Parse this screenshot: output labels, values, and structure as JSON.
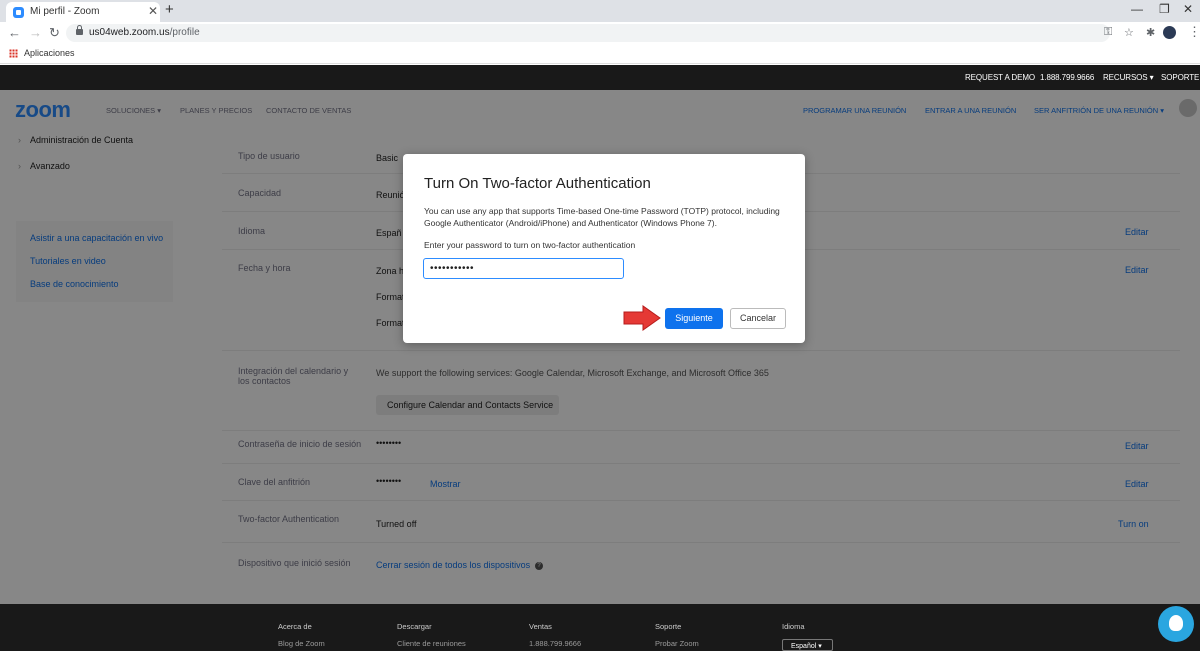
{
  "browser": {
    "tab_title": "Mi perfil - Zoom",
    "url_host": "us04web.zoom.us",
    "url_path": "/profile",
    "bookmark_apps": "Aplicaciones"
  },
  "topbar": {
    "request_demo": "REQUEST A DEMO",
    "phone": "1.888.799.9666",
    "recursos": "RECURSOS",
    "soporte": "SOPORTE"
  },
  "nav": {
    "logo": "zoom",
    "soluciones": "SOLUCIONES",
    "planes": "PLANES Y PRECIOS",
    "contacto": "CONTACTO DE VENTAS",
    "programar": "PROGRAMAR UNA REUNIÓN",
    "entrar": "ENTRAR A UNA REUNIÓN",
    "anfitrion": "SER ANFITRIÓN DE UNA REUNIÓN"
  },
  "sidebar": {
    "items": [
      {
        "label": "Administración de Cuenta"
      },
      {
        "label": "Avanzado"
      }
    ],
    "help": [
      {
        "label": "Asistir a una capacitación en vivo"
      },
      {
        "label": "Tutoriales en video"
      },
      {
        "label": "Base de conocimiento"
      }
    ]
  },
  "profile": {
    "tipo_usuario": {
      "label": "Tipo de usuario",
      "value": "Basic"
    },
    "capacidad": {
      "label": "Capacidad",
      "value": "Reunió"
    },
    "idioma": {
      "label": "Idioma",
      "value": "Españ",
      "edit": "Editar"
    },
    "fecha_hora": {
      "label": "Fecha y hora",
      "zona": "Zona h",
      "formato1": "Format",
      "formato2": "Format",
      "edit": "Editar"
    },
    "calendario": {
      "label": "Integración del calendario y los contactos",
      "value": "We support the following services: Google Calendar, Microsoft Exchange, and Microsoft Office 365",
      "button": "Configure Calendar and Contacts Service"
    },
    "contrasena": {
      "label": "Contraseña de inicio de sesión",
      "value": "••••••••",
      "edit": "Editar"
    },
    "clave": {
      "label": "Clave del anfitrión",
      "value": "••••••••",
      "show": "Mostrar",
      "edit": "Editar"
    },
    "two_factor": {
      "label": "Two-factor Authentication",
      "value": "Turned off",
      "action": "Turn on"
    },
    "dispositivo": {
      "label": "Dispositivo que inició sesión",
      "value": "Cerrar sesión de todos los dispositivos",
      "help": "?"
    }
  },
  "footer": {
    "cols": [
      {
        "title": "Acerca de",
        "first": "Blog de Zoom"
      },
      {
        "title": "Descargar",
        "first": "Cliente de reuniones"
      },
      {
        "title": "Ventas",
        "first": "1.888.799.9666"
      },
      {
        "title": "Soporte",
        "first": "Probar Zoom"
      },
      {
        "title": "Idioma",
        "first": "Español"
      }
    ]
  },
  "modal": {
    "title": "Turn On Two-factor Authentication",
    "description": "You can use any app that supports Time-based One-time Password (TOTP) protocol, including Google Authenticator (Android/iPhone) and Authenticator (Windows Phone 7).",
    "prompt": "Enter your password to turn on two-factor authentication",
    "password_value": "•••••••••••",
    "next_label": "Siguiente",
    "cancel_label": "Cancelar"
  },
  "colors": {
    "accent": "#0e72ed",
    "brand": "#2d8cff",
    "arrow": "#e53935"
  }
}
